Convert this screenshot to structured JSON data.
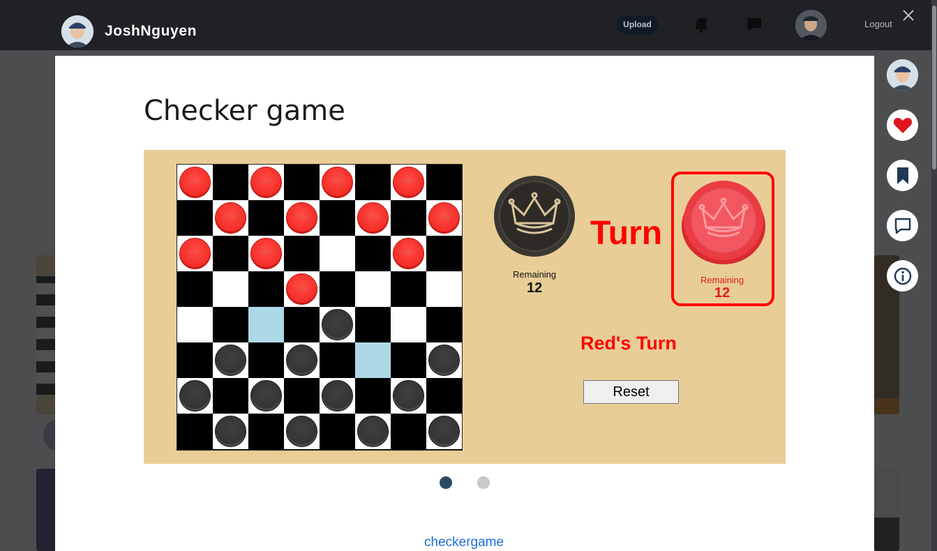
{
  "header": {
    "username": "JoshNguyen",
    "upload_label": "Upload",
    "logout_label": "Logout",
    "icons": [
      "bell-icon",
      "chat-icon",
      "close-icon"
    ]
  },
  "shot": {
    "title": "Checker game",
    "link_text": "checkergame",
    "carousel": {
      "total": 2,
      "active": 1
    }
  },
  "game": {
    "board": [
      [
        "r",
        "",
        "r",
        "",
        "r",
        "",
        "r",
        ""
      ],
      [
        "",
        "r",
        "",
        "r",
        "",
        "r",
        "",
        "r"
      ],
      [
        "r",
        "",
        "r",
        "",
        "",
        "",
        "r",
        ""
      ],
      [
        "",
        "",
        "",
        "r",
        "",
        "",
        "",
        ""
      ],
      [
        "",
        "",
        "h",
        "",
        "b",
        "",
        "",
        ""
      ],
      [
        "",
        "b",
        "",
        "b",
        "",
        "h",
        "",
        "b"
      ],
      [
        "b",
        "",
        "b",
        "",
        "b",
        "",
        "b",
        ""
      ],
      [
        "",
        "b",
        "",
        "b",
        "",
        "b",
        "",
        "b"
      ]
    ],
    "turn_label": "Turn",
    "black_player": {
      "remaining_label": "Remaining",
      "remaining": "12"
    },
    "red_player": {
      "remaining_label": "Remaining",
      "remaining": "12"
    },
    "status": "Red's Turn",
    "reset_label": "Reset"
  },
  "actions": [
    "avatar",
    "heart-icon",
    "bookmark-icon",
    "comment-icon",
    "info-icon"
  ],
  "colors": {
    "game_bg": "#e8cd97",
    "red": "#ff0000",
    "highlight": "#add8e6",
    "link": "#1a6fd8"
  }
}
